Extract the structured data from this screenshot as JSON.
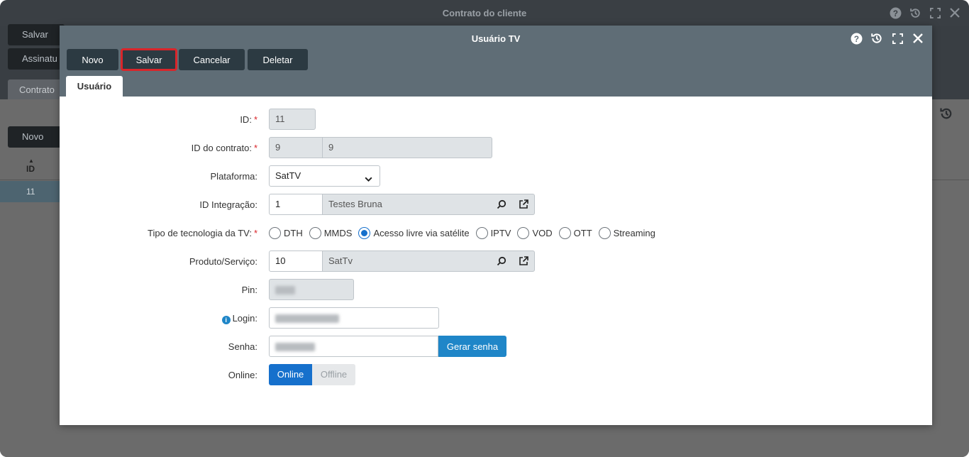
{
  "bg_window": {
    "title": "Contrato do cliente",
    "buttons": [
      "Salvar",
      "Assinatu"
    ],
    "tab": "Contrato",
    "novo": "Novo",
    "table_header": "ID",
    "row_id": "11"
  },
  "modal": {
    "title": "Usuário TV",
    "toolbar": {
      "novo": "Novo",
      "salvar": "Salvar",
      "cancelar": "Cancelar",
      "deletar": "Deletar"
    },
    "tab": "Usuário"
  },
  "form": {
    "id": {
      "label": "ID:",
      "value": "11"
    },
    "id_contrato": {
      "label": "ID do contrato:",
      "value": "9",
      "description": "9"
    },
    "plataforma": {
      "label": "Plataforma:",
      "value": "SatTV"
    },
    "id_integracao": {
      "label": "ID Integração:",
      "value": "1",
      "description": "Testes Bruna"
    },
    "tipo_tecnologia": {
      "label": "Tipo de tecnologia da TV:",
      "options": [
        "DTH",
        "MMDS",
        "Acesso livre via satélite",
        "IPTV",
        "VOD",
        "OTT",
        "Streaming"
      ],
      "selected": "Acesso livre via satélite"
    },
    "produto": {
      "label": "Produto/Serviço:",
      "value": "10",
      "description": "SatTv"
    },
    "pin": {
      "label": "Pin:"
    },
    "login": {
      "label": "Login:"
    },
    "senha": {
      "label": "Senha:",
      "gerar": "Gerar senha"
    },
    "online": {
      "label": "Online:",
      "on": "Online",
      "off": "Offline"
    }
  },
  "required_mark": "*"
}
